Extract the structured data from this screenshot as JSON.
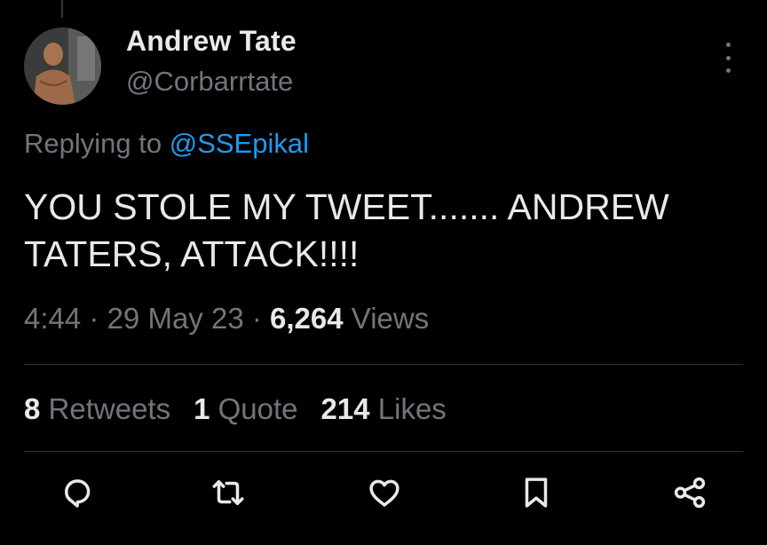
{
  "author": {
    "name": "Andrew Tate",
    "handle": "@Corbarrtate",
    "avatar_icon": "avatar-photo"
  },
  "reply": {
    "prefix": "Replying to",
    "to_handle": "@SSEpikal"
  },
  "tweet": {
    "text": "YOU STOLE MY TWEET....... ANDREW TATERS, ATTACK!!!!"
  },
  "meta": {
    "time": "4:44",
    "separator": "·",
    "date": "29 May 23",
    "views_count": "6,264",
    "views_label": "Views"
  },
  "stats": [
    {
      "count": "8",
      "label": "Retweets"
    },
    {
      "count": "1",
      "label": "Quote"
    },
    {
      "count": "214",
      "label": "Likes"
    }
  ],
  "actions": [
    {
      "icon": "reply-icon"
    },
    {
      "icon": "retweet-icon"
    },
    {
      "icon": "like-icon"
    },
    {
      "icon": "bookmark-icon"
    },
    {
      "icon": "share-icon"
    }
  ],
  "colors": {
    "background": "#000000",
    "text": "#e7e9ea",
    "secondary": "#71767b",
    "link": "#1d9bf0",
    "divider": "#2f3336"
  }
}
